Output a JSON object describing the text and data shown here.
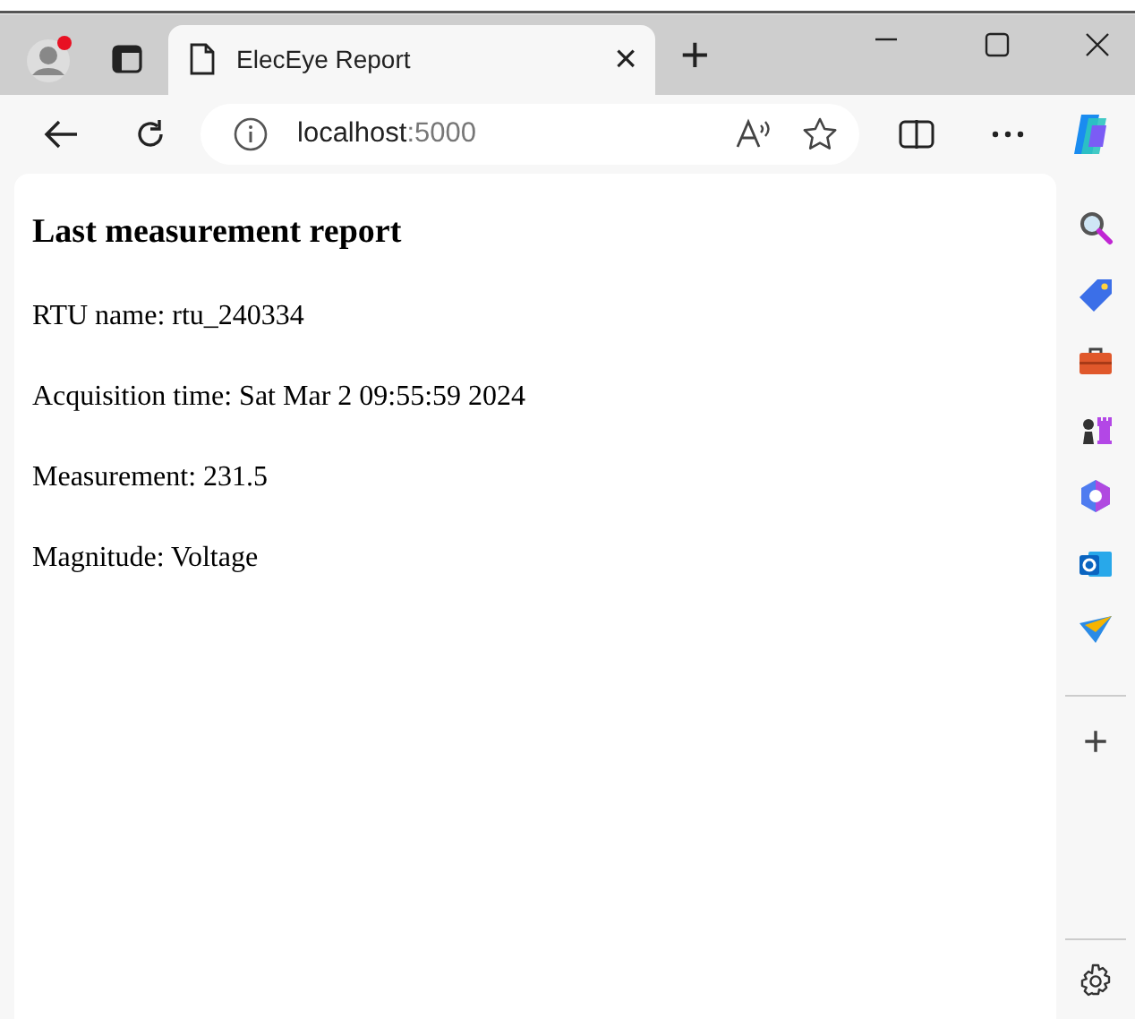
{
  "tab": {
    "title": "ElecEye Report",
    "close": "×",
    "new_tab": "+"
  },
  "address_bar": {
    "host": "localhost",
    "port": ":5000"
  },
  "page": {
    "heading": "Last measurement report",
    "lines": [
      "RTU name: rtu_240334",
      "Acquisition time: Sat Mar 2 09:55:59 2024",
      "Measurement: 231.5",
      "Magnitude: Voltage"
    ]
  },
  "sidebar": {
    "add": "+"
  }
}
